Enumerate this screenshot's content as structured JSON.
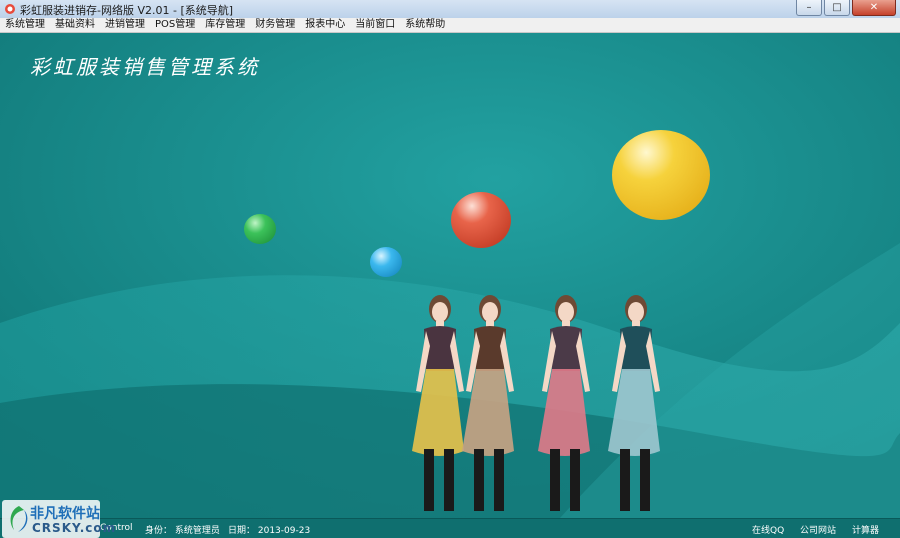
{
  "window": {
    "title": "彩虹服装进销存-网络版 V2.01 - [系统导航]",
    "buttons": {
      "minimize": "–",
      "maximize": "□",
      "close": "✕"
    }
  },
  "menu": [
    "系统管理",
    "基础资料",
    "进销管理",
    "POS管理",
    "库存管理",
    "财务管理",
    "报表中心",
    "当前窗口",
    "系统帮助"
  ],
  "main": {
    "app_title": "彩虹服装销售管理系统",
    "colors": {
      "background": "#188a8a",
      "bubble_yellow": "#f2c21e",
      "bubble_red": "#d9452b",
      "bubble_green": "#1f9a3a",
      "bubble_blue": "#22a6e0"
    },
    "figures": [
      {
        "name": "yellow-skirt-model",
        "skirt": "#e8c24a"
      },
      {
        "name": "tan-skirt-model",
        "skirt": "#c9a383"
      },
      {
        "name": "pink-skirt-model",
        "skirt": "#e07a88"
      },
      {
        "name": "teal-skirt-model",
        "skirt": "#9ec7cf"
      }
    ]
  },
  "status": {
    "control": "Control",
    "identity": "身份：  系统管理员",
    "date": "日期：  2013-09-23",
    "qq": "在线QQ",
    "website": "公司网站",
    "calculator": "计算器"
  },
  "watermark": {
    "cn": "非凡软件站",
    "en": "CRSKY.com"
  }
}
